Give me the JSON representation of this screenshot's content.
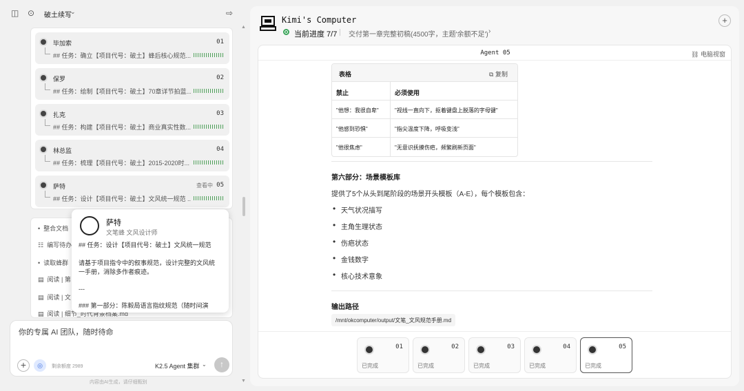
{
  "sidebar": {
    "chat_title": "破土续写",
    "agents": [
      {
        "name": "毕加索",
        "num": "01",
        "task": "## 任务：确立【项目代号：破土】蜂后核心规范..."
      },
      {
        "name": "保罗",
        "num": "02",
        "task": "## 任务：绘制【项目代号：破土】70章详节拍蓝..."
      },
      {
        "name": "扎克",
        "num": "03",
        "task": "## 任务：构建【项目代号：破土】商业真实性数..."
      },
      {
        "name": "林总监",
        "num": "04",
        "task": "## 任务：梳理【项目代号：破土】2015-2020时..."
      },
      {
        "name": "萨特",
        "num": "05",
        "task": "## 任务：设计【项目代号：破土】文风统一规范 ...",
        "status": "查看中"
      }
    ],
    "steps": [
      {
        "icon": "•",
        "text": "整合文档"
      },
      {
        "icon": "☷",
        "text": "编写待办"
      },
      {
        "icon": "•",
        "text": "读取蜂群"
      },
      {
        "icon": "▤",
        "text": "阅读 | 第"
      },
      {
        "icon": "▤",
        "text": "阅读 | 文"
      },
      {
        "icon": "▤",
        "text": "阅读 | 细节_时代背景档案.md"
      }
    ],
    "popup": {
      "name": "萨特",
      "role": "文笔蜂 文风设计师",
      "line1": "## 任务：设计【项目代号：破土】文风统一规范",
      "line2": "请基于项目指令中的叙事规范，设计完整的文风统一手册，消除多作者痕迹。",
      "line3": "---",
      "line4": "### 第一部分：陈毅局语言指纹规范（随时间演"
    },
    "input_placeholder": "你的专属 AI 团队，随时待命",
    "quota": "剩余额度 2989",
    "model": "K2.5 Agent 集群",
    "disclaimer": "内容由AI生成，请仔细甄别"
  },
  "computer": {
    "title": "Kimi's Computer",
    "progress": "当前进度 7/7",
    "deliverable": "交付第一章完整初稿(4500字，主题'余额不足')",
    "inner_title": "Agent 05",
    "view_label": "电脑视窗",
    "table": {
      "label": "表格",
      "copy": "复制",
      "headers": [
        "禁止",
        "必须使用"
      ],
      "rows": [
        [
          "\"他想：我很自卑\"",
          "\"视线一直向下，抠着键盘上脱落的字母键\""
        ],
        [
          "\"他感到恐惧\"",
          "\"指尖温度下降，呼吸变浅\""
        ],
        [
          "\"他很焦虑\"",
          "\"无意识抚摸伤疤，频繁刷新页面\""
        ]
      ]
    },
    "section_title": "第六部分：场景模板库",
    "section_desc": "提供了5个从头到尾阶段的场景开头模板（A-E），每个模板包含：",
    "bullets": [
      "天气状况描写",
      "主角生理状态",
      "伤疤状态",
      "金钱数字",
      "核心技术意象"
    ],
    "output_label": "输出路径",
    "output_path": "/mnt/okcomputer/output/文笔_文风规范手册.md",
    "chips": [
      {
        "num": "01",
        "status": "已完成"
      },
      {
        "num": "02",
        "status": "已完成"
      },
      {
        "num": "03",
        "status": "已完成"
      },
      {
        "num": "04",
        "status": "已完成"
      },
      {
        "num": "05",
        "status": "已完成"
      }
    ]
  }
}
